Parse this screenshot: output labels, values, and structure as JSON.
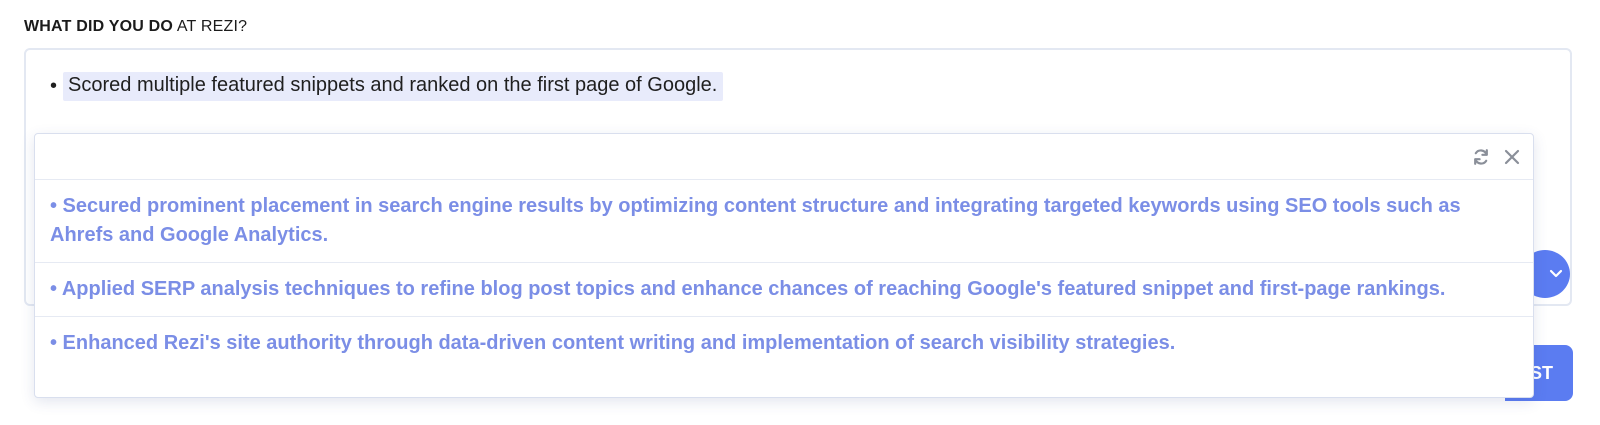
{
  "form": {
    "label_strong": "WHAT DID YOU DO",
    "label_rest": " AT REZI?",
    "bullet": "•",
    "current_bullet": "Scored multiple featured snippets and ranked on the first page of Google."
  },
  "suggestions_panel": {
    "refresh_icon": "refresh-icon",
    "close_icon": "close-icon",
    "items": [
      {
        "text": "• Secured prominent placement in search engine results by optimizing content structure and integrating targeted keywords using SEO tools such as Ahrefs and Google Analytics."
      },
      {
        "text": "• Applied SERP analysis techniques to refine blog post topics and enhance chances of reaching Google's featured snippet and first-page rankings."
      },
      {
        "text": "• Enhanced Rezi's site authority through data-driven content writing and implementation of search visibility strategies."
      }
    ]
  },
  "buttons": {
    "round_icon": "chevron-down-icon",
    "primary_partial_label": "ST"
  },
  "colors": {
    "accent": "#5b7cf1",
    "suggestion_text": "#7b8ee6",
    "selection_bg": "#e8ebfb"
  }
}
